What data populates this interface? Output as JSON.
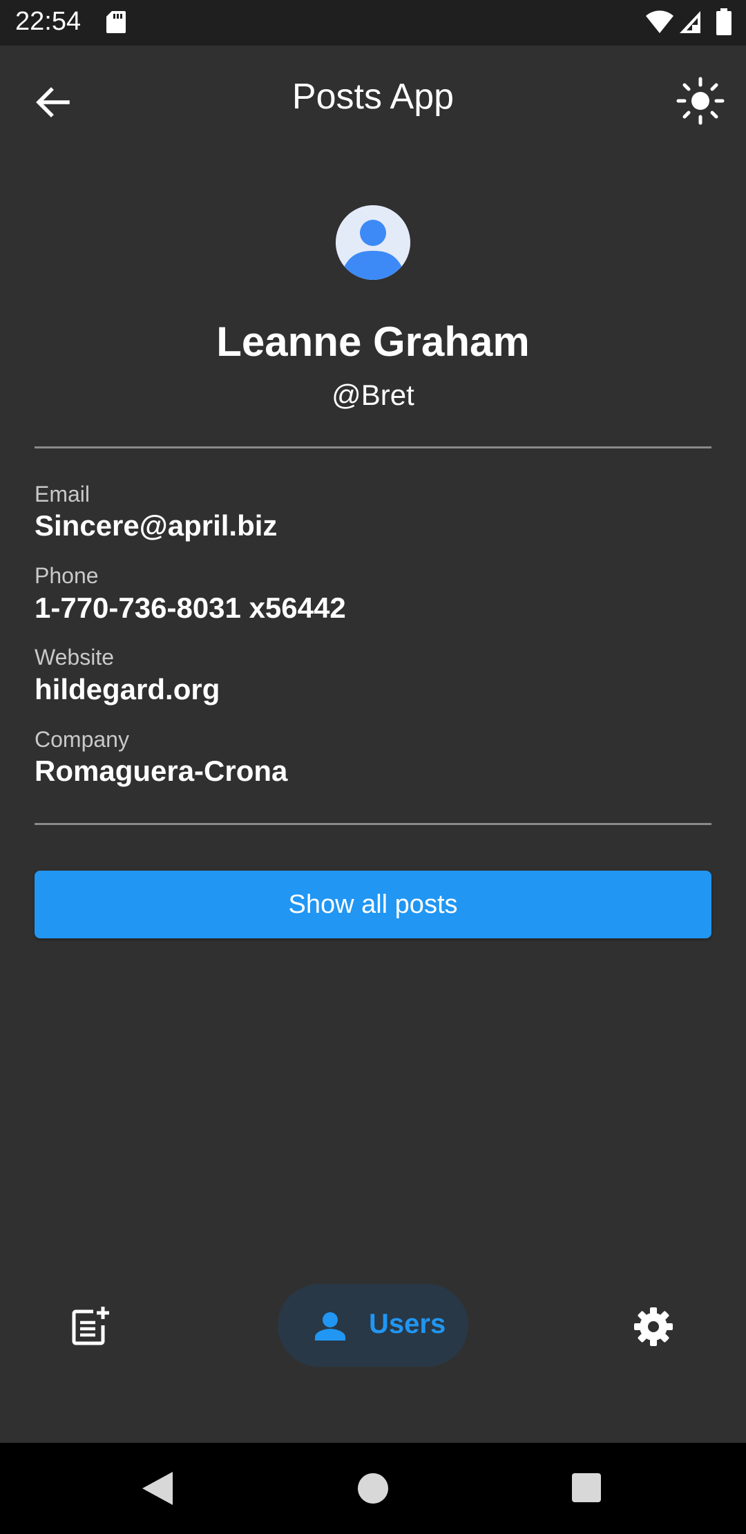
{
  "status_bar": {
    "time": "22:54"
  },
  "app_bar": {
    "title": "Posts App"
  },
  "user": {
    "name": "Leanne Graham",
    "handle": "@Bret",
    "fields": [
      {
        "label": "Email",
        "value": "Sincere@april.biz"
      },
      {
        "label": "Phone",
        "value": "1-770-736-8031 x56442"
      },
      {
        "label": "Website",
        "value": "hildegard.org"
      },
      {
        "label": "Company",
        "value": "Romaguera-Crona"
      }
    ]
  },
  "actions": {
    "show_posts_label": "Show all posts"
  },
  "bottom_nav": {
    "items": [
      {
        "icon": "post-add-icon",
        "label": "",
        "selected": false
      },
      {
        "icon": "person-icon",
        "label": "Users",
        "selected": true
      },
      {
        "icon": "gear-icon",
        "label": "",
        "selected": false
      }
    ]
  },
  "colors": {
    "background": "#303030",
    "status_bar": "#1f1f1f",
    "accent": "#2196f3",
    "nav_selected_pill": "#283846",
    "divider": "#8a8a8a",
    "label_text": "#c9c9c9"
  }
}
